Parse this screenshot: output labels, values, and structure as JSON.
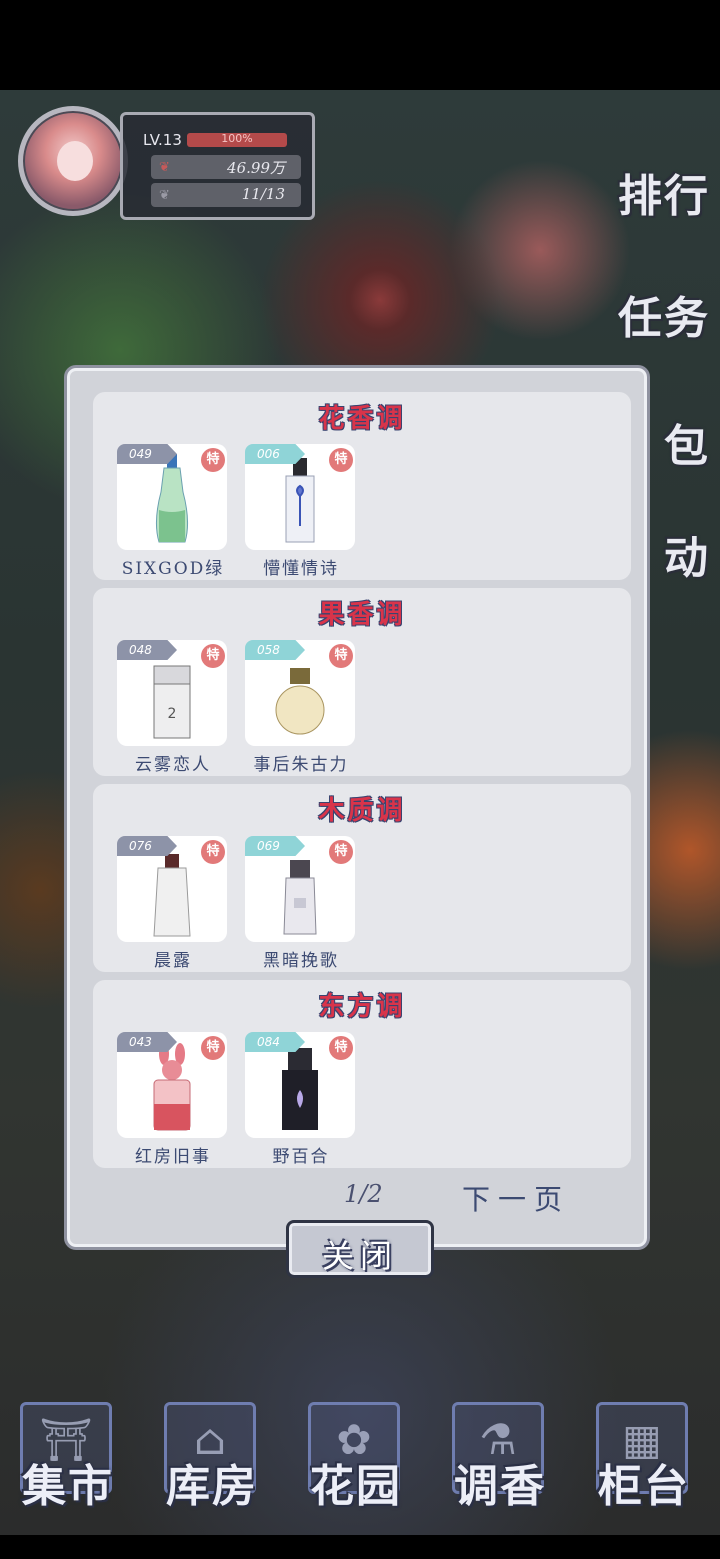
{
  "player": {
    "level": "LV.13",
    "exp": "100%",
    "money": "46.99万",
    "inventory": "11/13"
  },
  "side_menu": [
    {
      "label": "排行"
    },
    {
      "label": "任务"
    },
    {
      "label": "包"
    },
    {
      "label": "动"
    }
  ],
  "bottom_nav": [
    {
      "label": "集市"
    },
    {
      "label": "库房"
    },
    {
      "label": "花园"
    },
    {
      "label": "调香"
    },
    {
      "label": "柜台"
    }
  ],
  "modal": {
    "categories": [
      {
        "title": "花香调",
        "items": [
          {
            "id": "049",
            "badge": "特",
            "name": "SIXGOD绿"
          },
          {
            "id": "006",
            "badge": "特",
            "name": "懵懂情诗"
          }
        ]
      },
      {
        "title": "果香调",
        "items": [
          {
            "id": "048",
            "badge": "特",
            "name": "云雾恋人"
          },
          {
            "id": "058",
            "badge": "特",
            "name": "事后朱古力"
          }
        ]
      },
      {
        "title": "木质调",
        "items": [
          {
            "id": "076",
            "badge": "特",
            "name": "晨露"
          },
          {
            "id": "069",
            "badge": "特",
            "name": "黑暗挽歌"
          }
        ]
      },
      {
        "title": "东方调",
        "items": [
          {
            "id": "043",
            "badge": "特",
            "name": "红房旧事"
          },
          {
            "id": "084",
            "badge": "特",
            "name": "野百合"
          }
        ]
      }
    ],
    "page": "1/2",
    "next_label": "下一页",
    "close_label": "关闭"
  },
  "colors": {
    "category_title": "#d9344a",
    "badge": "#e27979",
    "id_gray": "#8d93a8",
    "id_teal": "#8fd4d7"
  }
}
